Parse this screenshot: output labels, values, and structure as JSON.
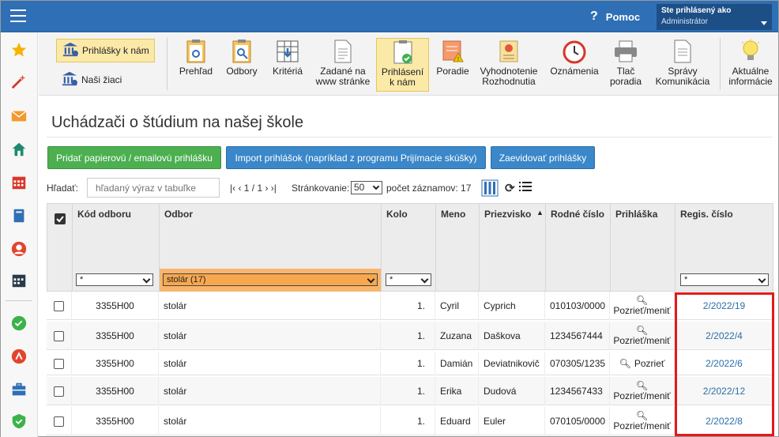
{
  "topbar": {
    "help_label": "Pomoc",
    "user_line1": "Ste prihlásený ako",
    "user_line2": "Administrátor"
  },
  "toolbar": {
    "left_buttons": [
      {
        "label": "Prihlášky k nám",
        "active": true
      },
      {
        "label": "Naši žiaci",
        "active": false
      }
    ],
    "tools": [
      {
        "l1": "Prehľad",
        "l2": ""
      },
      {
        "l1": "Odbory",
        "l2": ""
      },
      {
        "l1": "Kritériá",
        "l2": ""
      },
      {
        "l1": "Zadané na",
        "l2": "www stránke"
      },
      {
        "l1": "Prihlásení",
        "l2": "k nám"
      },
      {
        "l1": "Poradie",
        "l2": ""
      },
      {
        "l1": "Vyhodnotenie",
        "l2": "Rozhodnutia"
      },
      {
        "l1": "Oznámenia",
        "l2": ""
      },
      {
        "l1": "Tlač",
        "l2": "poradia"
      },
      {
        "l1": "Správy",
        "l2": "Komunikácia"
      },
      {
        "l1": "Aktuálne",
        "l2": "informácie"
      }
    ]
  },
  "page": {
    "title": "Uchádzači o štúdium na našej škole",
    "buttons": {
      "add": "Pridať papierovú / emailovú prihlášku",
      "import": "Import prihlášok (napríklad z programu Prijímacie skúšky)",
      "register": "Zaevidovať prihlášky"
    },
    "search": {
      "label": "Hľadať:",
      "placeholder": "hľadaný výraz v tabuľke",
      "pager": "|‹ ‹ 1 / 1 › ›|",
      "paging_label": "Stránkovanie:",
      "page_size": "50",
      "count_text": "počet záznamov: 17"
    }
  },
  "table": {
    "headers": {
      "code": "Kód odboru",
      "field": "Odbor",
      "round": "Kolo",
      "name": "Meno",
      "surname": "Priezvisko",
      "birth": "Rodné číslo",
      "application": "Prihláška",
      "reg": "Regis. číslo"
    },
    "filters": {
      "code": "*",
      "field": "stolár (17)",
      "round": "*",
      "reg": "*"
    },
    "rows": [
      {
        "code": "3355H00",
        "field": "stolár",
        "round": "1.",
        "name": "Cyril",
        "surname": "Cyprich",
        "birth": "010103/0000",
        "view": "Pozrieť/meniť",
        "reg": "2/2022/19"
      },
      {
        "code": "3355H00",
        "field": "stolár",
        "round": "1.",
        "name": "Zuzana",
        "surname": "Daškova",
        "birth": "1234567444",
        "view": "Pozrieť/meniť",
        "reg": "2/2022/4"
      },
      {
        "code": "3355H00",
        "field": "stolár",
        "round": "1.",
        "name": "Damián",
        "surname": "Deviatnikovič",
        "birth": "070305/1235",
        "view": "Pozrieť",
        "reg": "2/2022/6"
      },
      {
        "code": "3355H00",
        "field": "stolár",
        "round": "1.",
        "name": "Erika",
        "surname": "Dudová",
        "birth": "1234567433",
        "view": "Pozrieť/meniť",
        "reg": "2/2022/12"
      },
      {
        "code": "3355H00",
        "field": "stolár",
        "round": "1.",
        "name": "Eduard",
        "surname": "Euler",
        "birth": "070105/0000",
        "view": "Pozrieť/meniť",
        "reg": "2/2022/8"
      }
    ]
  }
}
